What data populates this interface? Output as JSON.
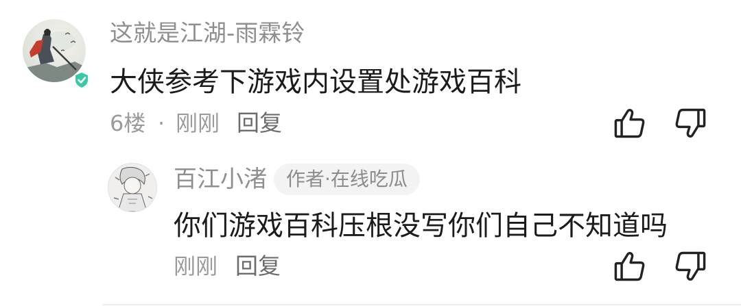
{
  "comment": {
    "username": "这就是江湖-雨霖铃",
    "text": "大侠参考下游戏内设置处游戏百科",
    "floor": "6楼",
    "separator": "·",
    "time": "刚刚",
    "reply_label": "回复",
    "verified_color": "#38c9a7",
    "icons": [
      "avatar-image",
      "verified-badge-icon",
      "thumbs-up-icon",
      "thumbs-down-icon"
    ]
  },
  "reply": {
    "username": "百江小渚",
    "badge": "作者·在线吃瓜",
    "text": "你们游戏百科压根没写你们自己不知道吗",
    "time": "刚刚",
    "reply_label": "回复",
    "icons": [
      "avatar-image",
      "thumbs-up-icon",
      "thumbs-down-icon"
    ]
  }
}
